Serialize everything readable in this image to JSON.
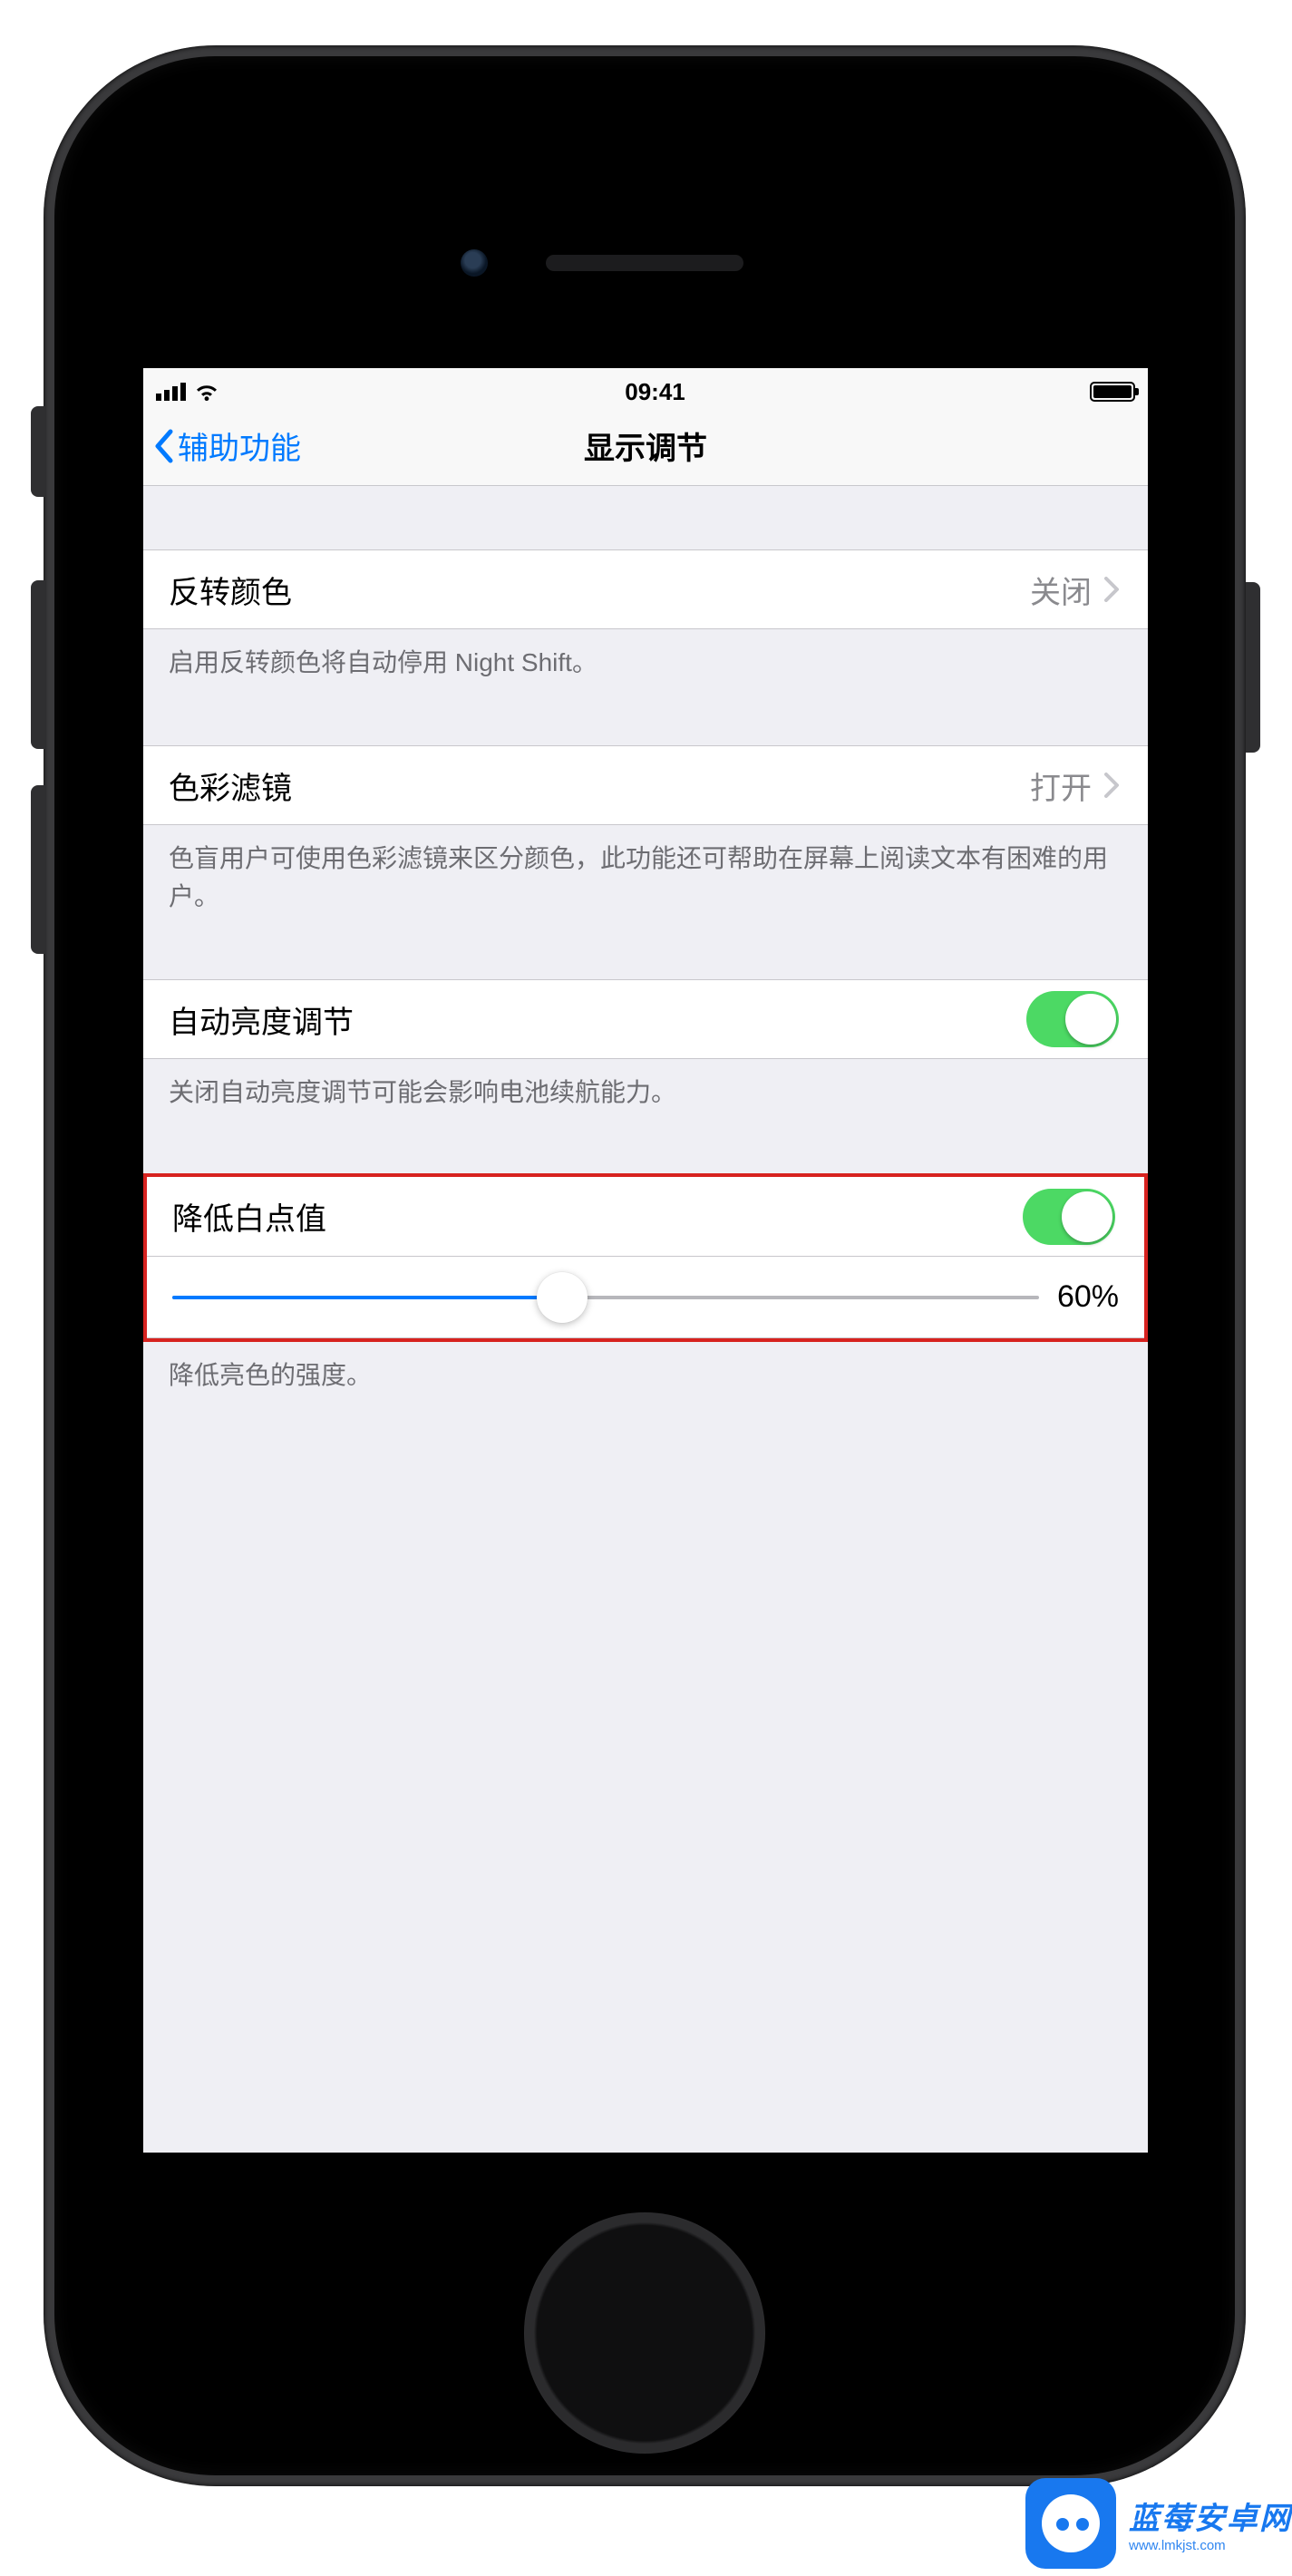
{
  "status": {
    "time": "09:41"
  },
  "nav": {
    "back": "辅助功能",
    "title": "显示调节"
  },
  "rows": {
    "invert": {
      "label": "反转颜色",
      "value": "关闭",
      "note": "启用反转颜色将自动停用 Night Shift。"
    },
    "filter": {
      "label": "色彩滤镜",
      "value": "打开",
      "note": "色盲用户可使用色彩滤镜来区分颜色，此功能还可帮助在屏幕上阅读文本有困难的用户。"
    },
    "auto": {
      "label": "自动亮度调节",
      "note": "关闭自动亮度调节可能会影响电池续航能力。"
    },
    "white": {
      "label": "降低白点值",
      "percent": "60%",
      "note": "降低亮色的强度。"
    }
  },
  "watermark": {
    "name": "蓝莓安卓网",
    "url": "www.lmkjst.com"
  }
}
